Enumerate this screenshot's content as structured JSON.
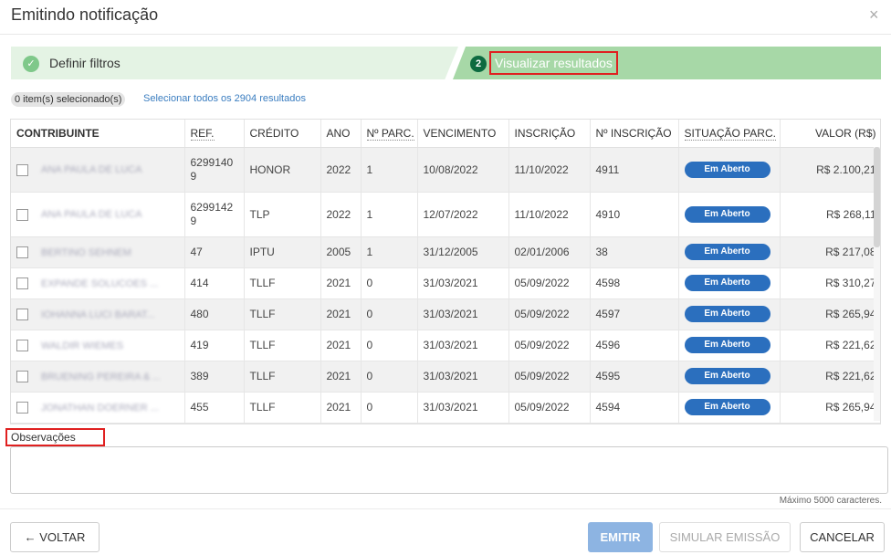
{
  "modal": {
    "title": "Emitindo notificação",
    "close": "×"
  },
  "wizard": {
    "step1": {
      "label": "Definir filtros",
      "check": "✓"
    },
    "step2": {
      "number": "2",
      "label": "Visualizar resultados"
    }
  },
  "selection": {
    "badge": "0 item(s) selecionado(s)",
    "link": "Selecionar todos os 2904 resultados"
  },
  "table": {
    "headers": [
      "CONTRIBUINTE",
      "REF.",
      "CRÉDITO",
      "ANO",
      "Nº PARC.",
      "VENCIMENTO",
      "INSCRIÇÃO",
      "Nº INSCRIÇÃO",
      "SITUAÇÃO PARC.",
      "VALOR (R$)"
    ],
    "rows": [
      {
        "name": "ANA PAULA DE LUCA",
        "ref": "62991409",
        "credito": "HONOR",
        "ano": "2022",
        "parc": "1",
        "vencimento": "10/08/2022",
        "inscricao": "11/10/2022",
        "num_inscricao": "4911",
        "situacao": "Em Aberto",
        "valor": "R$ 2.100,21"
      },
      {
        "name": "ANA PAULA DE LUCA",
        "ref": "62991429",
        "credito": "TLP",
        "ano": "2022",
        "parc": "1",
        "vencimento": "12/07/2022",
        "inscricao": "11/10/2022",
        "num_inscricao": "4910",
        "situacao": "Em Aberto",
        "valor": "R$ 268,11"
      },
      {
        "name": "BERTINO SEHNEM",
        "ref": "47",
        "credito": "IPTU",
        "ano": "2005",
        "parc": "1",
        "vencimento": "31/12/2005",
        "inscricao": "02/01/2006",
        "num_inscricao": "38",
        "situacao": "Em Aberto",
        "valor": "R$ 217,08"
      },
      {
        "name": "EXPANDE SOLUCOES ...",
        "ref": "414",
        "credito": "TLLF",
        "ano": "2021",
        "parc": "0",
        "vencimento": "31/03/2021",
        "inscricao": "05/09/2022",
        "num_inscricao": "4598",
        "situacao": "Em Aberto",
        "valor": "R$ 310,27"
      },
      {
        "name": "IOHANNA LUCI BARAT...",
        "ref": "480",
        "credito": "TLLF",
        "ano": "2021",
        "parc": "0",
        "vencimento": "31/03/2021",
        "inscricao": "05/09/2022",
        "num_inscricao": "4597",
        "situacao": "Em Aberto",
        "valor": "R$ 265,94"
      },
      {
        "name": "WALDIR WIEMES",
        "ref": "419",
        "credito": "TLLF",
        "ano": "2021",
        "parc": "0",
        "vencimento": "31/03/2021",
        "inscricao": "05/09/2022",
        "num_inscricao": "4596",
        "situacao": "Em Aberto",
        "valor": "R$ 221,62"
      },
      {
        "name": "BRUENING PEREIRA & ...",
        "ref": "389",
        "credito": "TLLF",
        "ano": "2021",
        "parc": "0",
        "vencimento": "31/03/2021",
        "inscricao": "05/09/2022",
        "num_inscricao": "4595",
        "situacao": "Em Aberto",
        "valor": "R$ 221,62"
      },
      {
        "name": "JONATHAN DOERNER ...",
        "ref": "455",
        "credito": "TLLF",
        "ano": "2021",
        "parc": "0",
        "vencimento": "31/03/2021",
        "inscricao": "05/09/2022",
        "num_inscricao": "4594",
        "situacao": "Em Aberto",
        "valor": "R$ 265,94"
      }
    ]
  },
  "observations": {
    "label": "Observações",
    "value": "",
    "hint": "Máximo 5000 caracteres."
  },
  "buttons": {
    "back": "← VOLTAR",
    "emit": "EMITIR",
    "simulate": "SIMULAR EMISSÃO",
    "cancel": "CANCELAR"
  },
  "colors": {
    "status_badge": "#2b6fbe",
    "step1_bg": "#e4f3e4",
    "step2_bg": "#a7d8a7",
    "step_num": "#0d6b40",
    "highlight_box": "#e02020",
    "emit_button": "#8db4e2",
    "link": "#3a7dc0"
  }
}
